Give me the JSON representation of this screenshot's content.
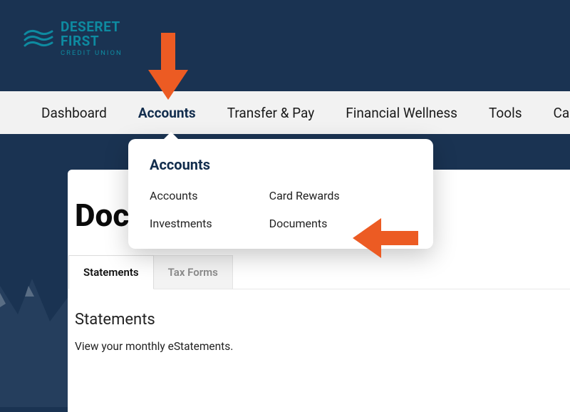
{
  "brand": {
    "name_line1": "DESERET",
    "name_line2": "FIRST",
    "subtitle": "CREDIT UNION",
    "accent": "#0e8aa0"
  },
  "nav": {
    "items": [
      {
        "label": "Dashboard"
      },
      {
        "label": "Accounts",
        "active": true
      },
      {
        "label": "Transfer & Pay"
      },
      {
        "label": "Financial Wellness"
      },
      {
        "label": "Tools"
      },
      {
        "label": "Cards"
      }
    ]
  },
  "dropdown": {
    "title": "Accounts",
    "col1": [
      {
        "label": "Accounts"
      },
      {
        "label": "Investments"
      }
    ],
    "col2": [
      {
        "label": "Card Rewards"
      },
      {
        "label": "Documents"
      }
    ]
  },
  "page": {
    "title": "Documents",
    "tabs": [
      {
        "label": "Statements",
        "active": true
      },
      {
        "label": "Tax Forms",
        "active": false
      }
    ],
    "section": {
      "heading": "Statements",
      "description": "View your monthly eStatements."
    }
  },
  "annotation": {
    "arrow_color": "#ec5b23"
  }
}
